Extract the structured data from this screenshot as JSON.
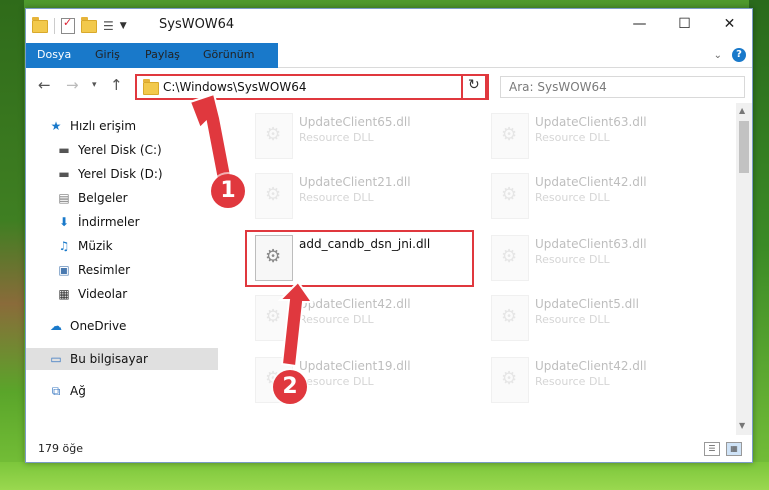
{
  "window": {
    "title": "SysWOW64"
  },
  "ribbon": {
    "tabs": [
      "Dosya",
      "Giriş",
      "Paylaş",
      "Görünüm"
    ]
  },
  "address": {
    "path": "C:\\Windows\\SysWOW64"
  },
  "search": {
    "placeholder": "Ara: SysWOW64"
  },
  "sidebar": {
    "items": [
      {
        "label": "Hızlı erişim",
        "icon": "star-icon"
      },
      {
        "label": "Yerel Disk (C:)",
        "icon": "drive-icon",
        "pinned": true
      },
      {
        "label": "Yerel Disk (D:)",
        "icon": "drive-icon",
        "pinned": true
      },
      {
        "label": "Belgeler",
        "icon": "documents-icon",
        "pinned": true
      },
      {
        "label": "İndirmeler",
        "icon": "download-icon",
        "pinned": true
      },
      {
        "label": "Müzik",
        "icon": "music-icon",
        "pinned": true
      },
      {
        "label": "Resimler",
        "icon": "pictures-icon",
        "pinned": true
      },
      {
        "label": "Videolar",
        "icon": "videos-icon",
        "pinned": true
      },
      {
        "label": "OneDrive",
        "icon": "cloud-icon"
      },
      {
        "label": "Bu bilgisayar",
        "icon": "computer-icon",
        "selected": true
      },
      {
        "label": "Ağ",
        "icon": "network-icon"
      }
    ]
  },
  "files": {
    "left": [
      {
        "name": "UpdateClient65.dll",
        "type": "Resource DLL"
      },
      {
        "name": "UpdateClient21.dll",
        "type": "Resource DLL"
      },
      {
        "name": "add_candb_dsn_jni.dll",
        "type": ""
      },
      {
        "name": "UpdateClient42.dll",
        "type": "Resource DLL"
      },
      {
        "name": "UpdateClient19.dll",
        "type": "Resource DLL"
      }
    ],
    "right": [
      {
        "name": "UpdateClient63.dll",
        "type": "Resource DLL"
      },
      {
        "name": "UpdateClient42.dll",
        "type": "Resource DLL"
      },
      {
        "name": "UpdateClient63.dll",
        "type": "Resource DLL"
      },
      {
        "name": "UpdateClient5.dll",
        "type": "Resource DLL"
      },
      {
        "name": "UpdateClient42.dll",
        "type": "Resource DLL"
      }
    ]
  },
  "status": {
    "count": "179 öğe"
  },
  "annotations": {
    "step1": "1",
    "step2": "2"
  },
  "colors": {
    "accent": "#1979ca",
    "highlight": "#e0383e"
  }
}
